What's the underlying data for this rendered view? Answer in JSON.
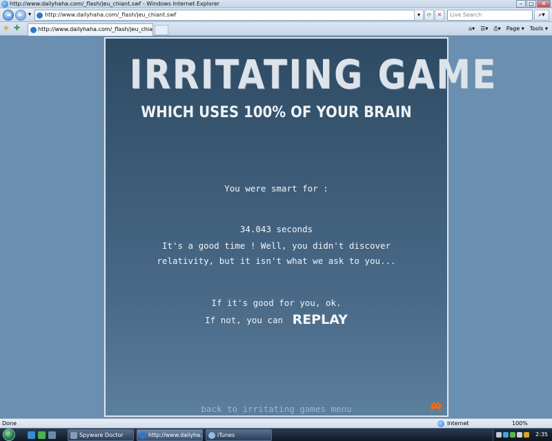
{
  "window": {
    "title": "http://www.dailyhaha.com/_flash/jeu_chiant.swf - Windows Internet Explorer",
    "controls": {
      "minimize": "–",
      "maximize": "□",
      "close": "✕"
    }
  },
  "address_bar": {
    "url": "http://www.dailyhaha.com/_flash/jeu_chiant.swf",
    "back_glyph": "◄",
    "forward_glyph": "►",
    "search_placeholder": "Live Search"
  },
  "tab_bar": {
    "tab_label": "http://www.dailyhaha.com/_flash/jeu_chiant.swf",
    "tools": {
      "page": "Page ▾",
      "tools": "Tools ▾"
    }
  },
  "game": {
    "title": "IRRITATING GAME",
    "subtitle": "WHICH USES 100% OF YOUR BRAIN",
    "smart_for": "You were smart for :",
    "time": "34.043 seconds",
    "message": "It's a good time ! Well, you didn't discover relativity, but it isn't what we ask to you...",
    "good_for_you": "If it's good for you, ok.",
    "if_not": "If not, you can",
    "replay": "REPLAY",
    "back_link": "back to irritating games menu"
  },
  "status_bar": {
    "status": "Done",
    "zone": "Internet",
    "zoom": "100%"
  },
  "taskbar": {
    "items": [
      {
        "label": "Spyware Doctor",
        "color": "#8a9bb0"
      },
      {
        "label": "http://www.dailyha...",
        "color": "#2c78c9"
      },
      {
        "label": "iTunes",
        "color": "#8fbfe0"
      }
    ],
    "clock": "2:35"
  }
}
